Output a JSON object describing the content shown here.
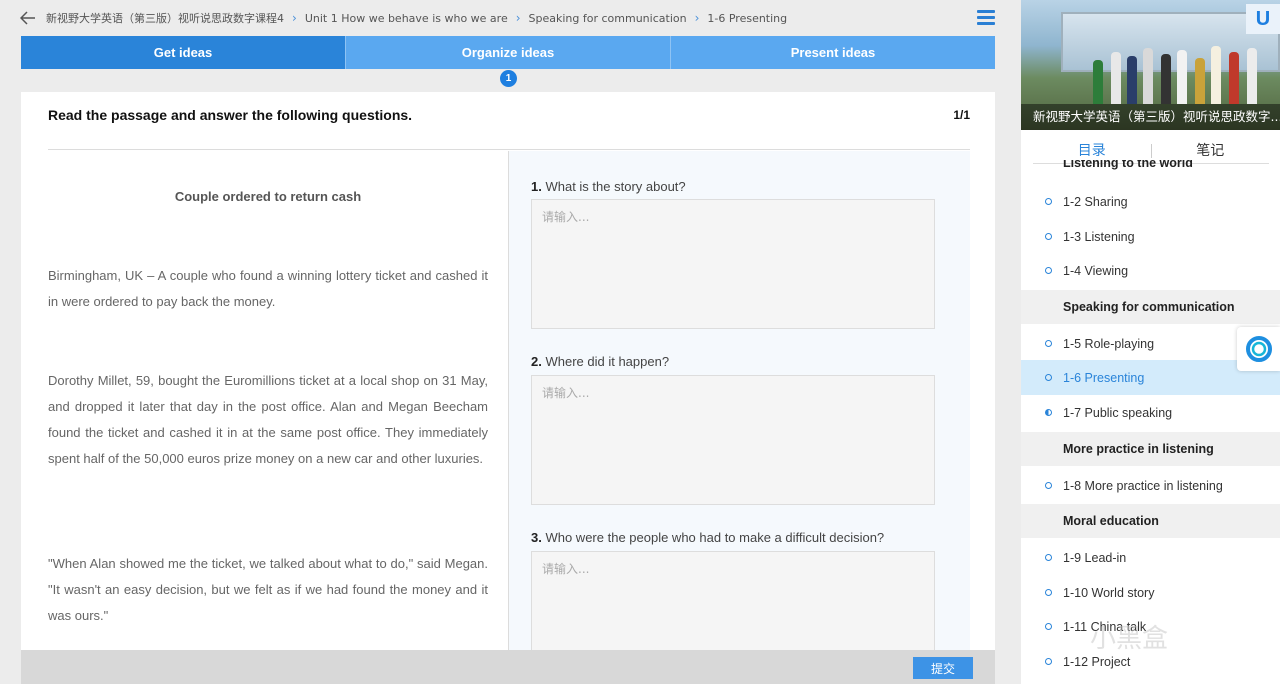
{
  "breadcrumb": {
    "items": [
      "新视野大学英语（第三版）视听说思政数字课程4",
      "Unit 1 How we behave is who we are",
      "Speaking for communication",
      "1-6 Presenting"
    ]
  },
  "steps": {
    "items": [
      "Get ideas",
      "Organize ideas",
      "Present ideas"
    ],
    "active_index": 0,
    "current_badge": "1"
  },
  "card": {
    "instruction": "Read the passage and answer the following questions.",
    "page": "1/1"
  },
  "passage": {
    "title": "Couple ordered to return cash",
    "paragraphs": [
      "Birmingham, UK – A couple who found a winning lottery ticket and cashed it in were ordered to pay back the money.",
      "Dorothy Millet, 59, bought the Euromillions ticket at a local shop on 31 May, and dropped it later that day in the post office. Alan and Megan Beecham found the ticket and cashed it in at the same post office. They immediately spent half of the 50,000 euros prize money on a new car and other luxuries.",
      "\"When Alan showed me the ticket, we talked about what to do,\" said Megan. \"It wasn't an easy decision, but we felt as if we had found the money and it was ours.\""
    ]
  },
  "questions": [
    {
      "num": "1.",
      "text": "What is the story about?",
      "placeholder": "请输入..."
    },
    {
      "num": "2.",
      "text": "Where did it happen?",
      "placeholder": "请输入..."
    },
    {
      "num": "3.",
      "text": "Who were the people who had to make a difficult decision?",
      "placeholder": "请输入..."
    }
  ],
  "footer": {
    "submit_label": "提交"
  },
  "sidebar": {
    "video_caption": "新视野大学英语（第三版）视听说思政数字...",
    "logo": "U",
    "tabs": [
      "目录",
      "笔记"
    ],
    "active_tab": 0,
    "cut_heading": "Listening to the world",
    "toc": [
      {
        "kind": "item",
        "label": "1-2 Sharing"
      },
      {
        "kind": "item",
        "label": "1-3 Listening"
      },
      {
        "kind": "item",
        "label": "1-4 Viewing"
      },
      {
        "kind": "section",
        "label": "Speaking for communication"
      },
      {
        "kind": "item",
        "label": "1-5 Role-playing"
      },
      {
        "kind": "item",
        "label": "1-6 Presenting",
        "active": true
      },
      {
        "kind": "item",
        "label": "1-7 Public speaking",
        "half": true
      },
      {
        "kind": "section",
        "label": "More practice in listening"
      },
      {
        "kind": "item",
        "label": "1-8 More practice in listening"
      },
      {
        "kind": "section",
        "label": "Moral education"
      },
      {
        "kind": "item",
        "label": "1-9 Lead-in"
      },
      {
        "kind": "item",
        "label": "1-10 World story"
      },
      {
        "kind": "item",
        "label": "1-11 China talk"
      },
      {
        "kind": "item",
        "label": "1-12 Project"
      }
    ],
    "watermark": "小黑盒"
  },
  "colors": {
    "accent": "#2a84d9",
    "tab_inactive": "#5aa8f0",
    "active_row": "#d3ebfb"
  }
}
